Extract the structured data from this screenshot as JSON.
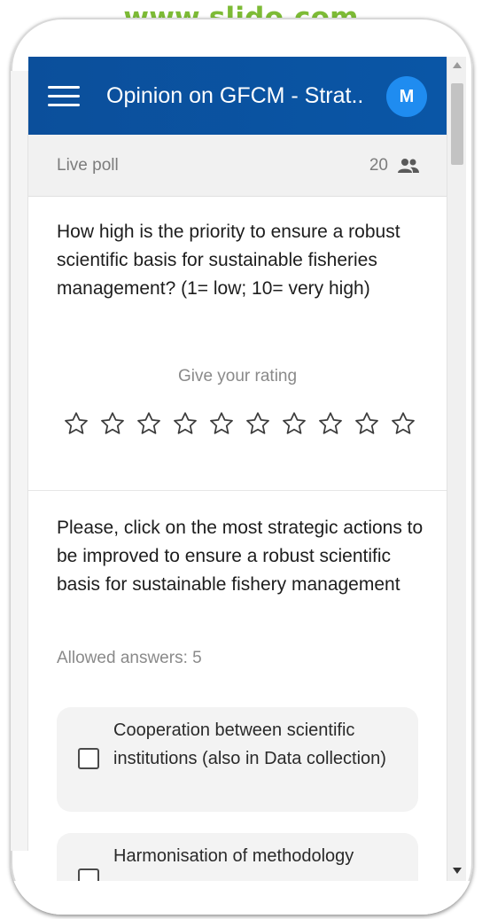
{
  "banner": {
    "url": "www.slido.com"
  },
  "app_bar": {
    "title": "Opinion on GFCM - Strat...",
    "avatar_initial": "M",
    "menu_icon": "hamburger-menu-icon"
  },
  "poll_header": {
    "label": "Live poll",
    "participant_count": "20",
    "participants_icon": "people-icon"
  },
  "question1": {
    "text": "How high is the priority to ensure a robust scientific basis for sustainable fisheries management? (1= low; 10= very high)",
    "rating_prompt": "Give your rating",
    "star_count": 10,
    "rating_value": 0
  },
  "question2": {
    "text": "Please, click on the most strategic actions to be improved to ensure a robust scientific basis for sustainable fishery management",
    "allowed_answers": "Allowed answers: 5",
    "options": [
      {
        "label": "Cooperation between scientific institutions (also in Data collection)",
        "checked": false
      },
      {
        "label": "Harmonisation of methodology",
        "checked": false
      }
    ]
  },
  "colors": {
    "accent": "#0b4f9b",
    "avatar": "#1f8cf0",
    "banner": "#7dbb36"
  }
}
